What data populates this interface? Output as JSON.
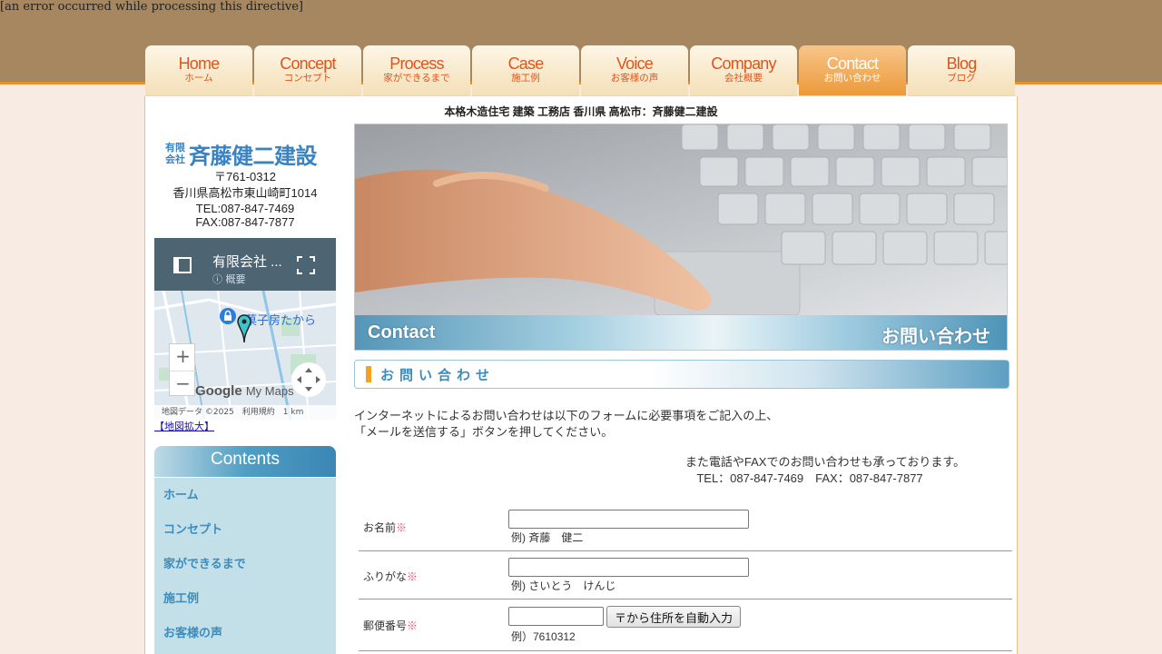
{
  "error_message": "[an error occurred while processing this directive]",
  "nav": [
    {
      "en": "Home",
      "jp": "ホーム",
      "active": false
    },
    {
      "en": "Concept",
      "jp": "コンセプト",
      "active": false
    },
    {
      "en": "Process",
      "jp": "家ができるまで",
      "active": false
    },
    {
      "en": "Case",
      "jp": "施工例",
      "active": false
    },
    {
      "en": "Voice",
      "jp": "お客様の声",
      "active": false
    },
    {
      "en": "Company",
      "jp": "会社概要",
      "active": false
    },
    {
      "en": "Contact",
      "jp": "お問い合わせ",
      "active": true
    },
    {
      "en": "Blog",
      "jp": "ブログ",
      "active": false
    }
  ],
  "tagline": "本格木造住宅 建築 工務店 香川県 高松市：斉藤健二建設",
  "company": {
    "logo_small": "有限会社",
    "logo_main": "斉藤健二建設",
    "zip": "〒761-0312",
    "address": "香川県高松市東山崎町1014",
    "tel": "TEL:087-847-7469",
    "fax": "FAX:087-847-7877"
  },
  "map": {
    "title": "有限会社 ...",
    "subtitle": "概要",
    "place": "菓子房たから",
    "brand": "Google",
    "brand_suffix": "My Maps",
    "footer": "地図データ ©2025　利用規約　1 km",
    "zoom_in": "+",
    "zoom_out": "−",
    "enlarge": "【地図拡大】"
  },
  "contents": {
    "heading": "Contents",
    "items": [
      "ホーム",
      "コンセプト",
      "家ができるまで",
      "施工例",
      "お客様の声"
    ]
  },
  "hero": {
    "en": "Contact",
    "jp": "お問い合わせ"
  },
  "section_title": "お問い合わせ",
  "intro": {
    "line1": "インターネットによるお問い合わせは以下のフォームに必要事項をご記入の上、",
    "line2": "「メールを送信する」ボタンを押してください。",
    "line3": "また電話やFAXでのお問い合わせも承っております。",
    "line4": "TEL：087-847-7469　FAX：087-847-7877"
  },
  "form": {
    "required_mark": "※",
    "name": {
      "label": "お名前",
      "value": "",
      "example": "例) 斉藤　健二"
    },
    "kana": {
      "label": "ふりがな",
      "value": "",
      "example": "例) さいとう　けんじ"
    },
    "zip": {
      "label": "郵便番号",
      "value": "",
      "example": "例）7610312",
      "button": "〒から住所を自動入力"
    }
  },
  "colors": {
    "header_bg": "#a68760",
    "nav_text": "#e0541b",
    "accent_orange": "#ec9a3a",
    "accent_blue": "#3b8cbd",
    "menu_bg": "#c3dfe8"
  }
}
